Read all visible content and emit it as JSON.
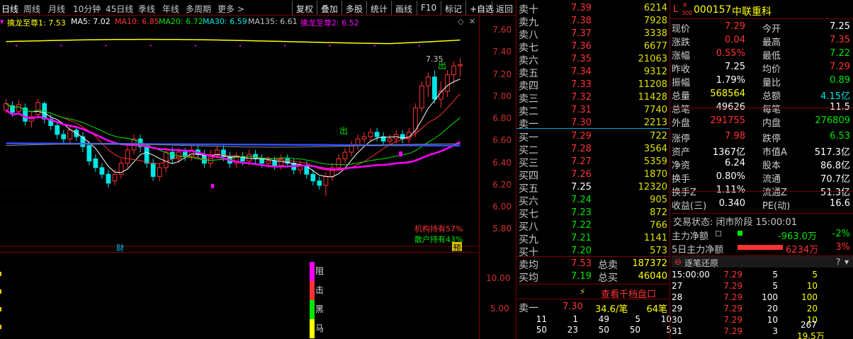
{
  "toolbar": {
    "periods": [
      "日线",
      "周线",
      "月线",
      "10分钟",
      "45日线",
      "季线",
      "年线",
      "多周期",
      "更多 >"
    ],
    "buttons": [
      "复权",
      "叠加",
      "多股",
      "统计",
      "画线",
      "F10",
      "标记",
      "+自选",
      "返回"
    ]
  },
  "indicators": {
    "main_name": "擒龙至尊1: 7.53",
    "ma5": "MA5: 7.02",
    "ma10": "MA10: 6.85",
    "ma20": "MA20: 6.72",
    "ma30": "MA30: 6.59",
    "ma135": "MA135: 6.61",
    "second_name": "擒龙至尊2: 6.52"
  },
  "colors": {
    "up": "#ff3232",
    "down": "#00e5e5",
    "ma5": "#ffffff",
    "ma10": "#ff3232",
    "ma20": "#00e600",
    "ma30": "#ff00ff",
    "ma135": "#3050ff",
    "line1": "#ffff00"
  },
  "chart_data": {
    "type": "candlestick",
    "y_axis": [
      "7.60",
      "7.40",
      "7.20",
      "7.00",
      "6.80",
      "6.60",
      "6.40",
      "6.20",
      "6.00",
      "5.80"
    ],
    "ylim": [
      5.7,
      7.62
    ],
    "last_high_label": "7.35",
    "markers": {
      "chu1": "出",
      "chu2": "出",
      "cai": "财",
      "yu": "预"
    },
    "holdings": {
      "inst": "机构持有57%",
      "retail": "散户持有43%"
    },
    "candles": [
      [
        6.88,
        6.94,
        6.85,
        6.98
      ],
      [
        6.92,
        6.86,
        6.82,
        6.96
      ],
      [
        6.87,
        6.93,
        6.84,
        6.97
      ],
      [
        6.9,
        6.78,
        6.74,
        6.94
      ],
      [
        6.78,
        6.82,
        6.72,
        6.86
      ],
      [
        6.84,
        6.95,
        6.8,
        6.98
      ],
      [
        6.94,
        6.8,
        6.76,
        6.96
      ],
      [
        6.8,
        6.74,
        6.7,
        6.84
      ],
      [
        6.74,
        6.66,
        6.62,
        6.78
      ],
      [
        6.66,
        6.62,
        6.58,
        6.7
      ],
      [
        6.62,
        6.7,
        6.58,
        6.73
      ],
      [
        6.7,
        6.64,
        6.6,
        6.74
      ],
      [
        6.64,
        6.55,
        6.5,
        6.68
      ],
      [
        6.56,
        6.42,
        6.38,
        6.6
      ],
      [
        6.44,
        6.36,
        6.32,
        6.48
      ],
      [
        6.36,
        6.3,
        6.26,
        6.4
      ],
      [
        6.3,
        6.22,
        6.18,
        6.34
      ],
      [
        6.24,
        6.3,
        6.2,
        6.34
      ],
      [
        6.3,
        6.4,
        6.26,
        6.44
      ],
      [
        6.4,
        6.52,
        6.36,
        6.56
      ],
      [
        6.52,
        6.62,
        6.48,
        6.66
      ],
      [
        6.62,
        6.55,
        6.5,
        6.66
      ],
      [
        6.55,
        6.4,
        6.36,
        6.58
      ],
      [
        6.4,
        6.28,
        6.24,
        6.44
      ],
      [
        6.28,
        6.36,
        6.24,
        6.4
      ],
      [
        6.36,
        6.5,
        6.32,
        6.54
      ],
      [
        6.5,
        6.44,
        6.4,
        6.55
      ],
      [
        6.44,
        6.5,
        6.4,
        6.54
      ],
      [
        6.5,
        6.46,
        6.42,
        6.54
      ],
      [
        6.46,
        6.52,
        6.42,
        6.56
      ],
      [
        6.52,
        6.48,
        6.44,
        6.56
      ],
      [
        6.48,
        6.4,
        6.36,
        6.52
      ],
      [
        6.4,
        6.48,
        6.36,
        6.52
      ],
      [
        6.48,
        6.52,
        6.44,
        6.56
      ],
      [
        6.52,
        6.46,
        6.42,
        6.56
      ],
      [
        6.46,
        6.4,
        6.36,
        6.5
      ],
      [
        6.4,
        6.46,
        6.36,
        6.5
      ],
      [
        6.46,
        6.42,
        6.38,
        6.5
      ],
      [
        6.42,
        6.48,
        6.38,
        6.52
      ],
      [
        6.48,
        6.44,
        6.4,
        6.52
      ],
      [
        6.44,
        6.4,
        6.36,
        6.48
      ],
      [
        6.4,
        6.42,
        6.36,
        6.46
      ],
      [
        6.42,
        6.38,
        6.34,
        6.46
      ],
      [
        6.38,
        6.44,
        6.34,
        6.48
      ],
      [
        6.44,
        6.4,
        6.36,
        6.48
      ],
      [
        6.4,
        6.34,
        6.3,
        6.44
      ],
      [
        6.34,
        6.38,
        6.3,
        6.42
      ],
      [
        6.38,
        6.3,
        6.26,
        6.42
      ],
      [
        6.3,
        6.24,
        6.2,
        6.34
      ],
      [
        6.24,
        6.2,
        6.16,
        6.28
      ],
      [
        6.2,
        6.28,
        6.1,
        6.32
      ],
      [
        6.28,
        6.36,
        6.24,
        6.4
      ],
      [
        6.36,
        6.44,
        6.32,
        6.48
      ],
      [
        6.44,
        6.5,
        6.4,
        6.54
      ],
      [
        6.5,
        6.56,
        6.46,
        6.6
      ],
      [
        6.56,
        6.62,
        6.52,
        6.66
      ],
      [
        6.62,
        6.64,
        6.58,
        6.68
      ],
      [
        6.64,
        6.68,
        6.6,
        6.72
      ],
      [
        6.68,
        6.64,
        6.6,
        6.72
      ],
      [
        6.64,
        6.6,
        6.56,
        6.68
      ],
      [
        6.6,
        6.62,
        6.56,
        6.66
      ],
      [
        6.62,
        6.66,
        6.58,
        6.7
      ],
      [
        6.66,
        6.62,
        6.58,
        6.7
      ],
      [
        6.62,
        6.68,
        6.58,
        6.72
      ],
      [
        6.68,
        6.9,
        6.64,
        6.94
      ],
      [
        6.9,
        7.1,
        6.86,
        7.14
      ],
      [
        7.1,
        7.18,
        7.0,
        7.22
      ],
      [
        7.18,
        6.98,
        6.94,
        7.24
      ],
      [
        6.98,
        7.05,
        6.9,
        7.14
      ],
      [
        7.05,
        7.2,
        7.0,
        7.24
      ],
      [
        7.2,
        7.28,
        7.12,
        7.32
      ],
      [
        7.28,
        7.29,
        7.18,
        7.35
      ]
    ],
    "lower_axis": [
      "10.00",
      "5.00"
    ],
    "lower_labels": [
      "阻",
      "击",
      "黑",
      "马"
    ]
  },
  "quote": {
    "asks": [
      {
        "label": "卖十",
        "price": "7.39",
        "vol": "6214"
      },
      {
        "label": "卖九",
        "price": "7.38",
        "vol": "7928"
      },
      {
        "label": "卖八",
        "price": "7.37",
        "vol": "3338"
      },
      {
        "label": "卖七",
        "price": "7.36",
        "vol": "6677"
      },
      {
        "label": "卖六",
        "price": "7.35",
        "vol": "21063"
      },
      {
        "label": "卖五",
        "price": "7.34",
        "vol": "9312"
      },
      {
        "label": "卖四",
        "price": "7.33",
        "vol": "11208"
      },
      {
        "label": "卖三",
        "price": "7.32",
        "vol": "11428"
      },
      {
        "label": "卖二",
        "price": "7.31",
        "vol": "7740"
      },
      {
        "label": "卖一",
        "price": "7.30",
        "vol": "2213"
      }
    ],
    "bids": [
      {
        "label": "买一",
        "price": "7.29",
        "vol": "722",
        "c": "red"
      },
      {
        "label": "买二",
        "price": "7.28",
        "vol": "3564",
        "c": "red"
      },
      {
        "label": "买三",
        "price": "7.27",
        "vol": "5359",
        "c": "red"
      },
      {
        "label": "买四",
        "price": "7.26",
        "vol": "1870",
        "c": "red"
      },
      {
        "label": "买五",
        "price": "7.25",
        "vol": "12320",
        "c": "white"
      },
      {
        "label": "买六",
        "price": "7.24",
        "vol": "905",
        "c": "green"
      },
      {
        "label": "买七",
        "price": "7.23",
        "vol": "872",
        "c": "green"
      },
      {
        "label": "买八",
        "price": "7.22",
        "vol": "766",
        "c": "green"
      },
      {
        "label": "买九",
        "price": "7.21",
        "vol": "1141",
        "c": "green"
      },
      {
        "label": "买十",
        "price": "7.20",
        "vol": "573",
        "c": "green"
      }
    ],
    "avg": {
      "sell_label": "卖均",
      "sell_price": "7.53",
      "sell_total_label": "总卖",
      "sell_total": "187372",
      "buy_label": "买均",
      "buy_price": "7.19",
      "buy_total_label": "总买",
      "buy_total": "46040"
    },
    "view_button": "查看千档盘口",
    "level1": {
      "label": "卖一",
      "price": "7.30",
      "amt": "34.6/笔",
      "count": "64笔"
    },
    "orders": [
      [
        "11",
        "1",
        "49",
        "5",
        "10"
      ],
      [
        "50",
        "23",
        "50",
        "50",
        "5"
      ]
    ]
  },
  "stock": {
    "badge_l": "L",
    "badge_r": "R",
    "badge_300": "300",
    "code": "000157",
    "name": "中联重科",
    "rows": [
      [
        [
          "现价",
          "white"
        ],
        [
          "7.29",
          "red"
        ],
        [
          "今开",
          "white"
        ],
        [
          "7.25",
          "white"
        ]
      ],
      [
        [
          "涨跌",
          "white"
        ],
        [
          "0.04",
          "red"
        ],
        [
          "最高",
          "white"
        ],
        [
          "7.35",
          "red"
        ]
      ],
      [
        [
          "涨幅",
          "white"
        ],
        [
          "0.55%",
          "red"
        ],
        [
          "最低",
          "white"
        ],
        [
          "7.22",
          "green"
        ]
      ],
      [
        [
          "昨收",
          "white"
        ],
        [
          "7.25",
          "white"
        ],
        [
          "均价",
          "white"
        ],
        [
          "7.29",
          "red"
        ]
      ],
      [
        [
          "振幅",
          "white"
        ],
        [
          "1.79%",
          "white"
        ],
        [
          "量比",
          "white"
        ],
        [
          "0.89",
          "green"
        ]
      ],
      [
        [
          "总量",
          "white"
        ],
        [
          "568564",
          "yellow"
        ],
        [
          "总额",
          "white"
        ],
        [
          "4.15亿",
          "cyan"
        ]
      ],
      [
        [
          "总笔",
          "white"
        ],
        [
          "49626",
          "white"
        ],
        [
          "每笔",
          "white"
        ],
        [
          "11.5",
          "white"
        ]
      ],
      [
        [
          "外盘",
          "white"
        ],
        [
          "291755",
          "red"
        ],
        [
          "内盘",
          "white"
        ],
        [
          "276809",
          "green"
        ]
      ]
    ],
    "rows2": [
      [
        [
          "涨停",
          "white"
        ],
        [
          "7.98",
          "red"
        ],
        [
          "跌停",
          "white"
        ],
        [
          "6.53",
          "green"
        ]
      ],
      [
        [
          "资产",
          "white"
        ],
        [
          "1367亿",
          "white"
        ],
        [
          "市值A",
          "white"
        ],
        [
          "517.3亿",
          "white"
        ]
      ],
      [
        [
          "净资",
          "white"
        ],
        [
          "6.24",
          "white"
        ],
        [
          "股本",
          "white"
        ],
        [
          "86.8亿",
          "white"
        ]
      ],
      [
        [
          "换手",
          "white"
        ],
        [
          "0.80%",
          "white"
        ],
        [
          "流通",
          "white"
        ],
        [
          "70.7亿",
          "white"
        ]
      ],
      [
        [
          "换手Z",
          "white"
        ],
        [
          "1.11%",
          "white"
        ],
        [
          "流通Z",
          "white"
        ],
        [
          "51.3亿",
          "white"
        ]
      ],
      [
        [
          "收益(三)",
          "white"
        ],
        [
          "0.340",
          "white"
        ],
        [
          "PE(动)",
          "white"
        ],
        [
          "16.6",
          "white"
        ]
      ]
    ],
    "status_label": "交易状态: 闭市阶段 15:00:01",
    "main_net_label": "主力净额",
    "main_net_val": "-963.0万",
    "main_net_pct": "-2%",
    "five_day_label": "5日主力净额",
    "five_day_val": "6234万",
    "five_day_pct": "3%",
    "ticks_title": "逐笔还原",
    "ticks": [
      [
        "15:00:00",
        "7.29",
        "5",
        "5"
      ],
      [
        "27",
        "7.29",
        "5",
        "10"
      ],
      [
        "28",
        "7.29",
        "100",
        "100"
      ],
      [
        "29",
        "7.29",
        "20",
        "20"
      ],
      [
        "30",
        "7.29",
        "10",
        "10"
      ],
      [
        "31",
        "7.29",
        "3",
        ""
      ]
    ],
    "tick_extra": [
      "267",
      "19.5万"
    ]
  }
}
